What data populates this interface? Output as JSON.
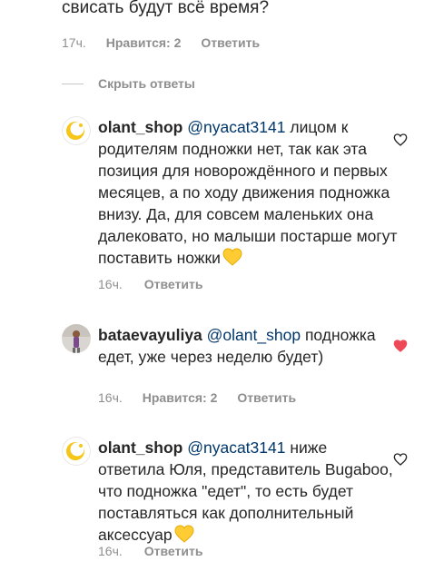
{
  "top_fragment": {
    "text": "свисать будут всё время?",
    "time": "17ч.",
    "likes": "Нравится: 2",
    "reply": "Ответить"
  },
  "hide_replies": "Скрыть ответы",
  "comments": [
    {
      "username": "olant_shop",
      "mention": "@nyacat3141",
      "text": "лицом к родителям подножки нет, так как эта позиция для новорождённого и первых месяцев, а по ходу движения подножка внизу. Да, для совсем маленьких она далековато, но малыши постарше могут поставить ножки",
      "emoji": "yellow-heart",
      "time": "16ч.",
      "reply": "Ответить",
      "liked": false,
      "avatar": "olant-shop-logo"
    },
    {
      "username": "bataevayuliya",
      "mention": "@olant_shop",
      "text": "подножка едет, уже через неделю будет)",
      "time": "16ч.",
      "likes": "Нравится: 2",
      "reply": "Ответить",
      "liked": true,
      "avatar": "user-photo"
    },
    {
      "username": "olant_shop",
      "mention": "@nyacat3141",
      "text": "ниже ответила Юля, представитель Bugaboo, что подножка \"едет\", то есть будет поставляться как дополнительный аксессуар",
      "emoji": "yellow-heart",
      "time": "16ч.",
      "reply": "Ответить",
      "liked": false,
      "avatar": "olant-shop-logo"
    }
  ],
  "colors": {
    "text": "#262626",
    "meta": "#8e8e8e",
    "mention": "#00376b",
    "liked_heart": "#ed4956",
    "yellow_heart": "#ffcc33",
    "logo_yellow": "#f5c518"
  }
}
